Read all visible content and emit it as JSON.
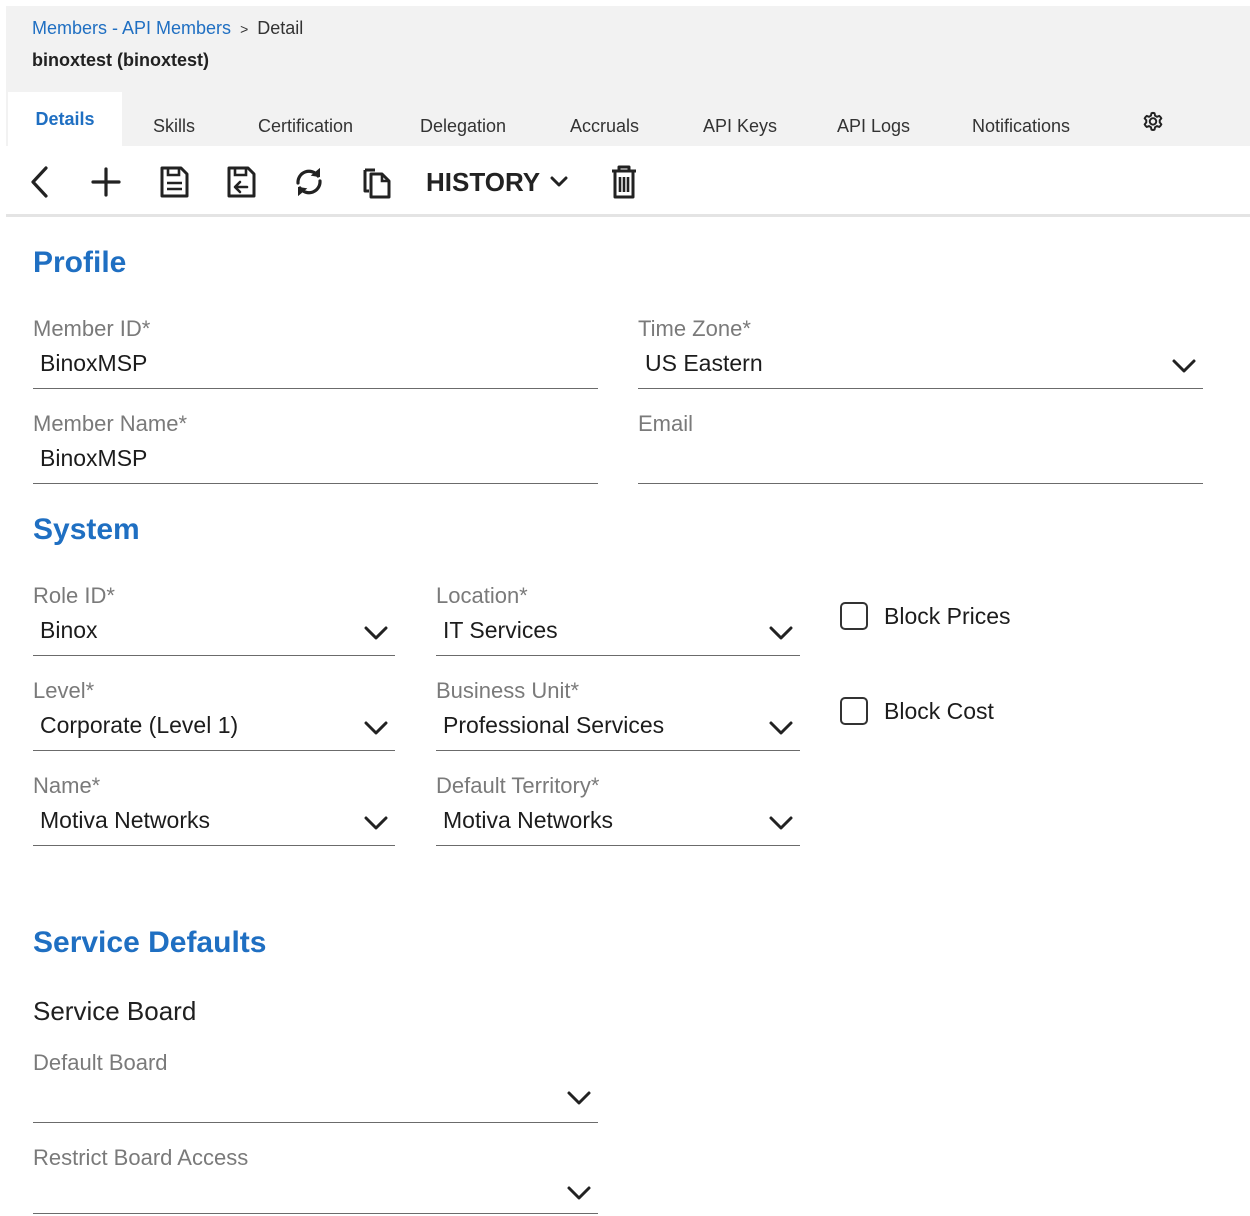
{
  "breadcrumb": {
    "link": "Members - API Members",
    "separator": ">",
    "current": "Detail"
  },
  "subtitle": "binoxtest (binoxtest)",
  "tabs": [
    {
      "label": "Details",
      "active": true
    },
    {
      "label": "Skills"
    },
    {
      "label": "Certification"
    },
    {
      "label": "Delegation"
    },
    {
      "label": "Accruals"
    },
    {
      "label": "API Keys"
    },
    {
      "label": "API Logs"
    },
    {
      "label": "Notifications"
    }
  ],
  "tab_settings_icon": "gear-icon",
  "toolbar": {
    "icons": [
      "back-icon",
      "add-icon",
      "save-icon",
      "save-and-close-icon",
      "refresh-icon",
      "copy-icon",
      "delete-icon"
    ],
    "history_label": "HISTORY"
  },
  "profile": {
    "title": "Profile",
    "member_id": {
      "label": "Member ID*",
      "value": "BinoxMSP"
    },
    "time_zone": {
      "label": "Time Zone*",
      "value": "US Eastern"
    },
    "member_name": {
      "label": "Member Name*",
      "value": "BinoxMSP"
    },
    "email": {
      "label": "Email",
      "value": ""
    }
  },
  "system": {
    "title": "System",
    "role_id": {
      "label": "Role ID*",
      "value": "Binox"
    },
    "location": {
      "label": "Location*",
      "value": "IT Services"
    },
    "level": {
      "label": "Level*",
      "value": "Corporate (Level 1)"
    },
    "business_unit": {
      "label": "Business Unit*",
      "value": "Professional Services"
    },
    "name": {
      "label": "Name*",
      "value": "Motiva Networks"
    },
    "default_territory": {
      "label": "Default Territory*",
      "value": "Motiva Networks"
    },
    "block_prices": {
      "label": "Block Prices",
      "checked": false
    },
    "block_cost": {
      "label": "Block Cost",
      "checked": false
    }
  },
  "service_defaults": {
    "title": "Service Defaults",
    "service_board_title": "Service Board",
    "default_board": {
      "label": "Default Board",
      "value": ""
    },
    "restrict_board_access": {
      "label": "Restrict Board Access",
      "value": ""
    }
  },
  "colors": {
    "accent": "#1f6fc2",
    "header_bg": "#f2f2f2",
    "label": "#7a7a7a"
  }
}
